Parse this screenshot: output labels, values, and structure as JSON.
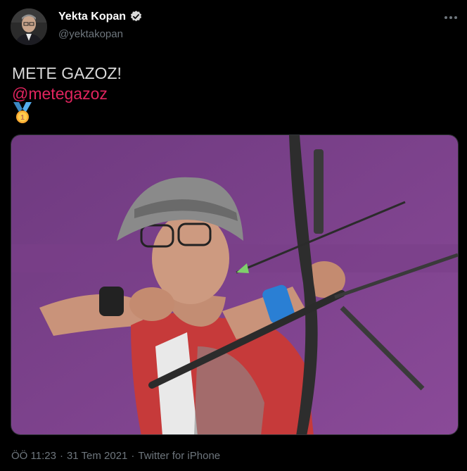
{
  "author": {
    "display_name": "Yekta Kopan",
    "handle": "@yektakopan",
    "verified": true
  },
  "tweet": {
    "text": "METE GAZOZ!",
    "mention": "@metegazoz",
    "emoji": "gold-medal",
    "media_icon": "archer-photo"
  },
  "meta": {
    "time": "ÖÖ 11:23",
    "separator": "·",
    "date": "31 Tem 2021",
    "separator2": "·",
    "source": "Twitter for iPhone"
  },
  "colors": {
    "background": "#000000",
    "text": "#d9d9d9",
    "secondary": "#6e767d",
    "mention": "#e0245e",
    "verified": "#d9d9d9",
    "photo_background": "#7b3d86"
  }
}
